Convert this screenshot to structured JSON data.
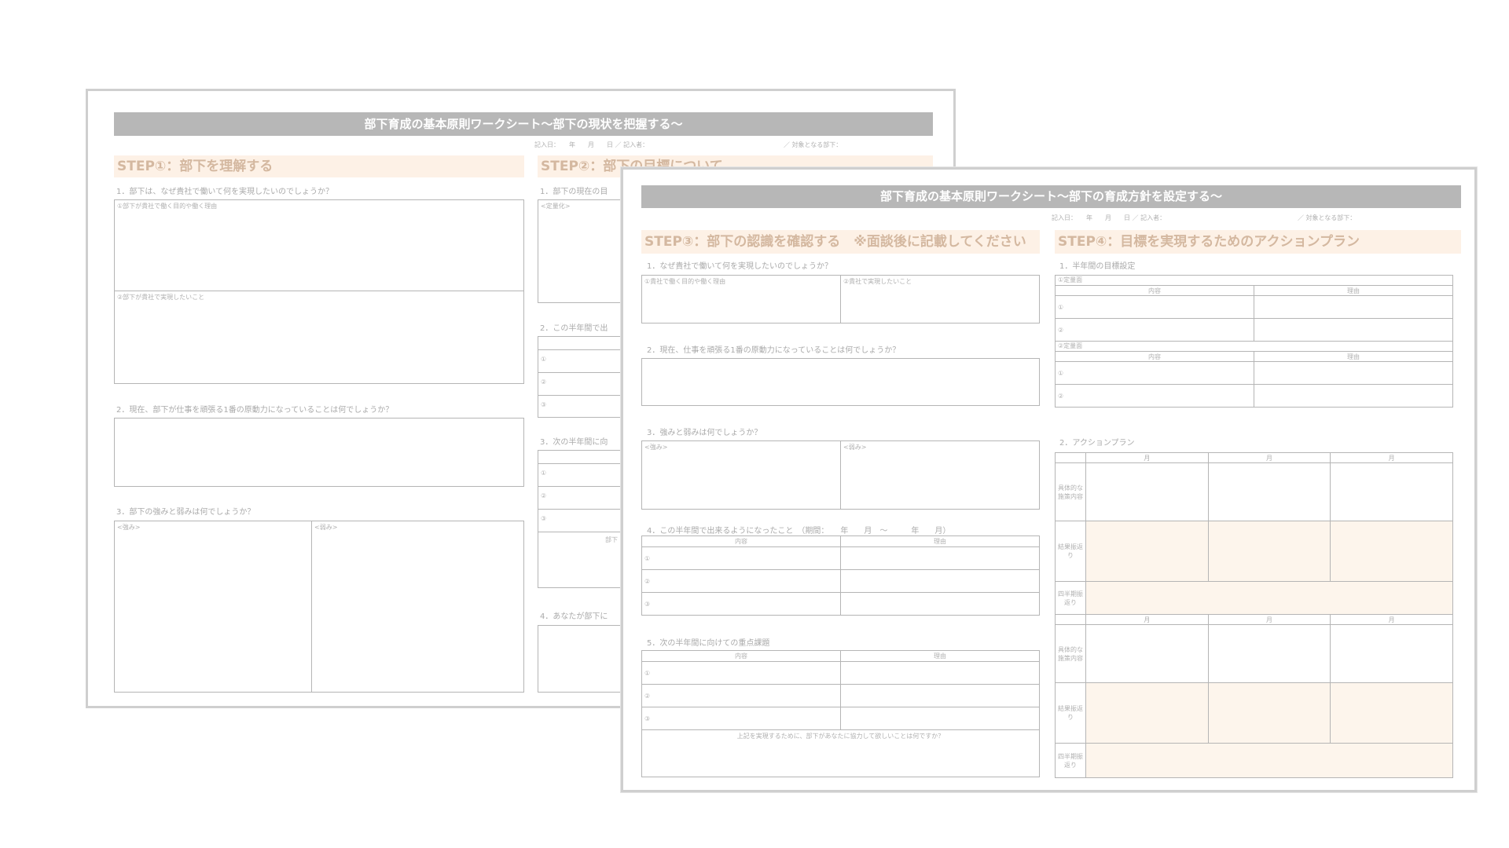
{
  "sheet1": {
    "title": "部下育成の基本原則ワークシート〜部下の現状を把握する〜",
    "meta_date": "記入日：　　年　　月　　日 ／ 記入者：",
    "meta_target": "／ 対象となる部下：",
    "step1": {
      "header": "STEP①：部下を理解する",
      "q1": "1．部下は、なぜ貴社で働いて何を実現したいのでしょうか？",
      "q1_box1": "①部下が貴社で働く目的や働く理由",
      "q1_box2": "②部下が貴社で実現したいこと",
      "q2": "2．現在、部下が仕事を頑張る1番の原動力になっていることは何でしょうか？",
      "q3": "3．部下の強みと弱みは何でしょうか？",
      "strength": "<強み>",
      "weakness": "<弱み>"
    },
    "step2": {
      "header": "STEP②：部下の目標について",
      "q1": "1．部下の現在の目",
      "q1_box": "<定量化>",
      "q2": "2．この半年間で出",
      "q3": "3．次の半年間に向",
      "q4": "4．あなたが部下に",
      "num1": "①",
      "num2": "②",
      "num3": "③",
      "cut_label": "部下"
    }
  },
  "sheet2": {
    "title": "部下育成の基本原則ワークシート〜部下の育成方針を設定する〜",
    "meta_date": "記入日：　　年　　月　　日 ／ 記入者：",
    "meta_target": "／ 対象となる部下：",
    "step3": {
      "header": "STEP③：部下の認識を確認する　※面談後に記載してください",
      "q1": "1．なぜ貴社で働いて何を実現したいのでしょうか？",
      "q1_col1": "①貴社で働く目的や働く理由",
      "q1_col2": "②貴社で実現したいこと",
      "q2": "2．現在、仕事を頑張る1番の原動力になっていることは何でしょうか？",
      "q3": "3．強みと弱みは何でしょうか？",
      "strength": "<強み>",
      "weakness": "<弱み>",
      "q4": "4．この半年間で出来るようになったこと　（期間：　　年　　月　〜　　　年　　月）",
      "q5": "5．次の半年間に向けての重点課題",
      "col_content": "内容",
      "col_reason": "理由",
      "num1": "①",
      "num2": "②",
      "num3": "③",
      "help_question": "上記を実現するために、部下があなたに協力して欲しいことは何ですか？"
    },
    "step4": {
      "header": "STEP④：目標を実現するためのアクションプラン",
      "q1": "1．半年間の目標設定",
      "goal1_label": "①定量面",
      "goal2_label": "②定量面",
      "col_content": "内容",
      "col_reason": "理由",
      "num1": "①",
      "num2": "②",
      "q2": "2．アクションプラン",
      "month": "月",
      "row_concrete": "具体的な施策内容",
      "row_result": "結果振返り",
      "row_half": "四半期振返り"
    }
  }
}
